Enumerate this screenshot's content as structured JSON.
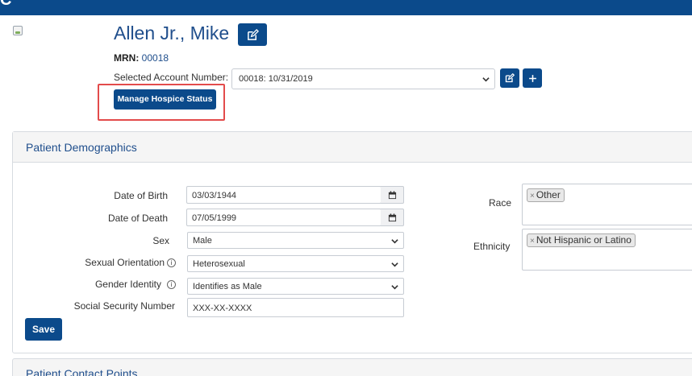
{
  "app": {
    "logo_text": "C"
  },
  "patient": {
    "name": "Allen Jr., Mike",
    "mrn_label": "MRN:",
    "mrn_value": "00018",
    "account_label": "Selected Account Number:",
    "account_value": "00018: 10/31/2019",
    "hospice_button": "Manage Hospice Status"
  },
  "demographics": {
    "title": "Patient Demographics",
    "fields": {
      "dob_label": "Date of Birth",
      "dob_value": "03/03/1944",
      "dod_label": "Date of Death",
      "dod_value": "07/05/1999",
      "sex_label": "Sex",
      "sex_value": "Male",
      "orientation_label": "Sexual Orientation",
      "orientation_value": "Heterosexual",
      "gender_label": "Gender Identity",
      "gender_value": "Identifies as Male",
      "ssn_label": "Social Security Number",
      "ssn_value": "XXX-XX-XXXX"
    },
    "race_label": "Race",
    "race_tags": [
      "Other"
    ],
    "ethnicity_label": "Ethnicity",
    "ethnicity_tags": [
      "Not Hispanic or Latino"
    ],
    "save_label": "Save"
  },
  "contact": {
    "title": "Patient Contact Points"
  },
  "icons": {
    "edit": "pencil-square-icon",
    "add": "plus-icon",
    "calendar": "calendar-icon",
    "chevron": "chevron-down-icon",
    "info": "info-circle-icon",
    "remove": "tag-remove-icon"
  },
  "colors": {
    "primary": "#0b4a8b",
    "link": "#1f4e8c",
    "highlight": "#e34b4b"
  }
}
